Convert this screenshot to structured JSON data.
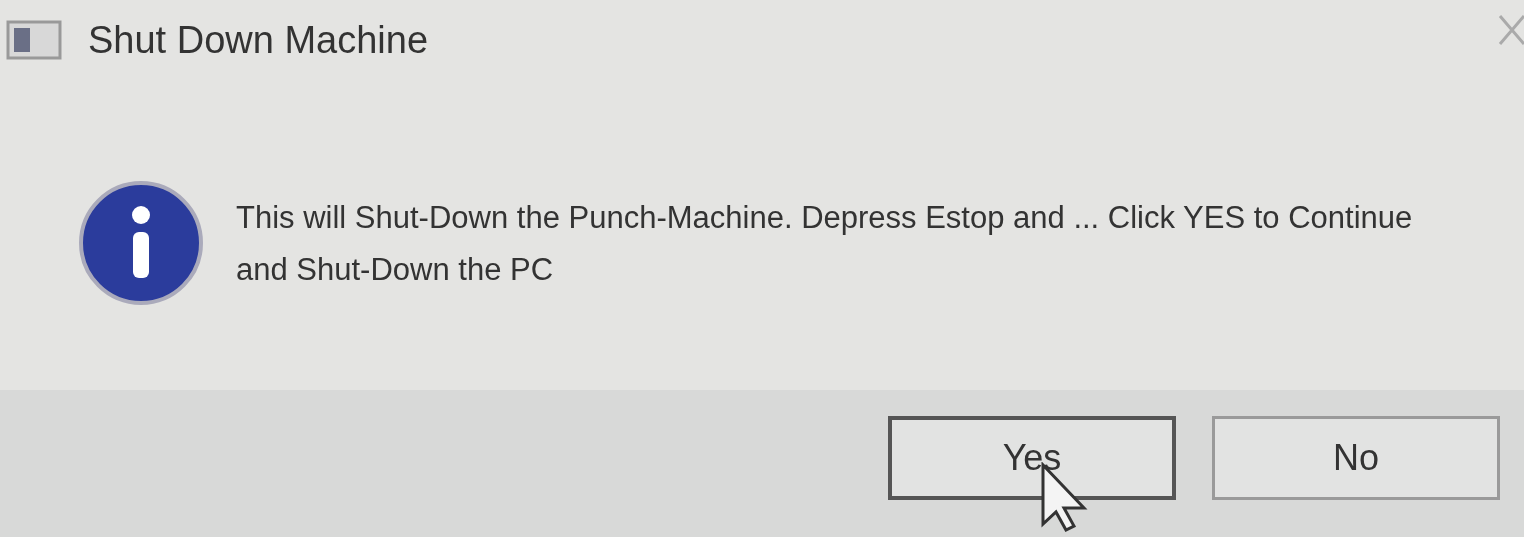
{
  "window": {
    "title": "Shut Down Machine"
  },
  "message": "This will Shut-Down the Punch-Machine. Depress Estop and ... Click YES to Continue and Shut-Down the PC",
  "buttons": [
    {
      "label": "Yes",
      "default": true
    },
    {
      "label": "No",
      "default": false
    }
  ]
}
